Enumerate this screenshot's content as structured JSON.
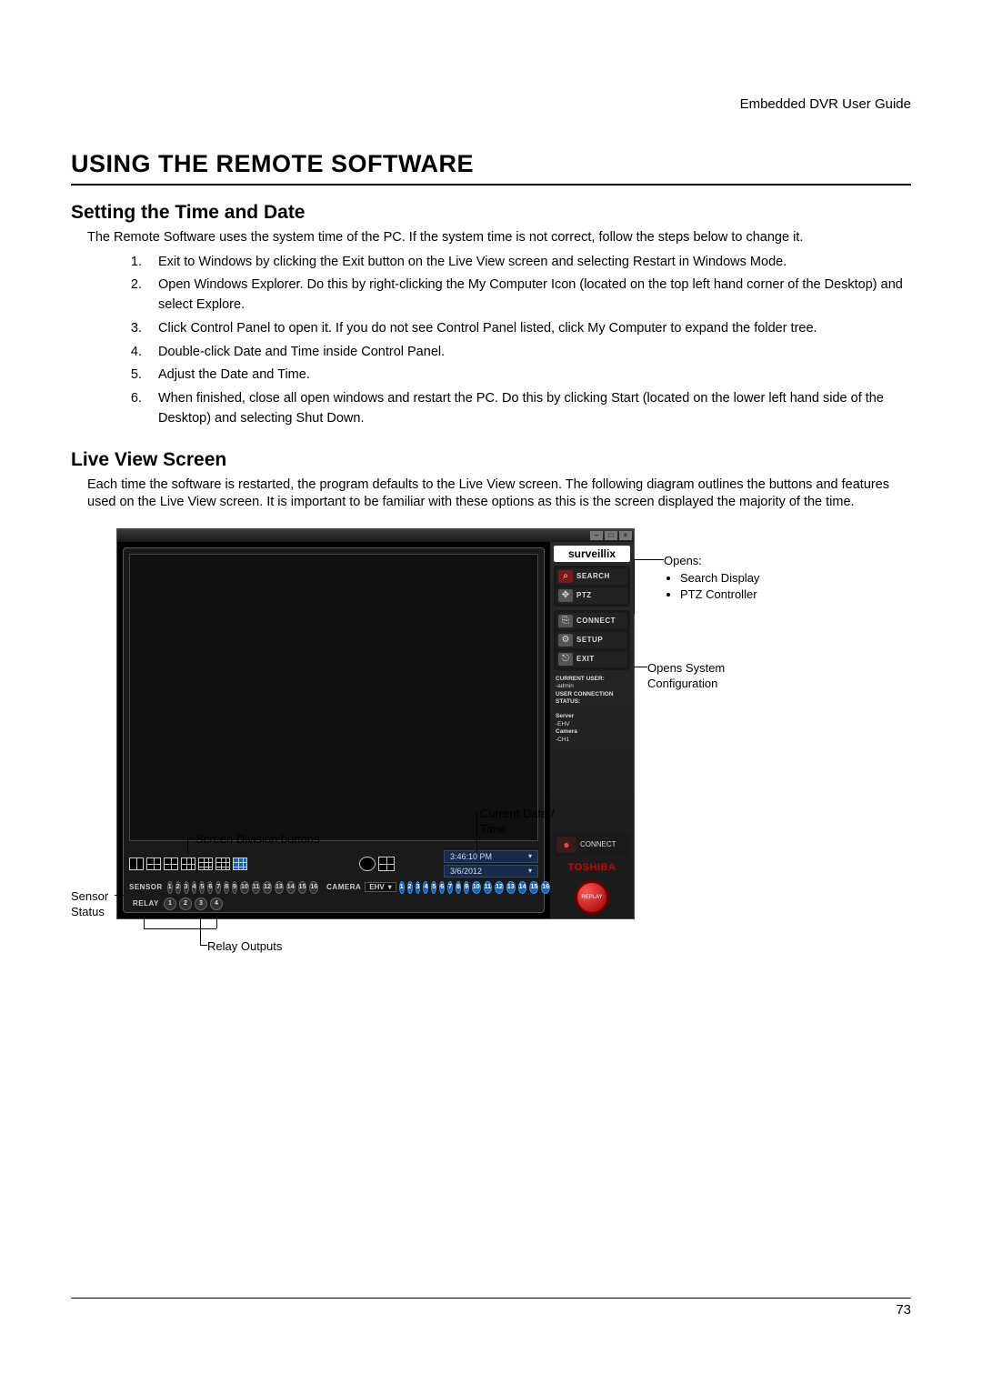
{
  "header_right": "Embedded DVR User Guide",
  "h1": "USING THE REMOTE SOFTWARE",
  "section1": {
    "title": "Setting the Time and Date",
    "intro": "The Remote Software uses the system time of the PC. If the system time is not correct, follow the steps below to change it.",
    "steps": [
      "Exit to Windows by clicking the Exit button on the Live View screen and selecting Restart in Windows Mode.",
      "Open Windows Explorer. Do this by right-clicking the My Computer Icon (located on the top left hand corner of the Desktop) and select Explore.",
      "Click Control Panel to open it. If you do not see Control Panel listed, click My Computer to expand the folder tree.",
      "Double-click Date and Time inside Control Panel.",
      "Adjust the Date and Time.",
      "When finished, close all open windows and restart the PC. Do this by clicking Start (located on the lower left hand side of the Desktop) and selecting Shut Down."
    ]
  },
  "section2": {
    "title": "Live View Screen",
    "intro": "Each time the software is restarted, the program defaults to the Live View screen. The following diagram outlines the buttons and features used on the Live View screen. It is important to be familiar with these options as this is the screen displayed the majority of the time."
  },
  "app": {
    "brand": "surveillix",
    "search": "SEARCH",
    "ptz": "PTZ",
    "connect": "CONNECT",
    "setup": "SETUP",
    "exit": "EXIT",
    "current_user_label": "CURRENT USER:",
    "current_user_value": "-admin",
    "ucs_label": "USER CONNECTION STATUS:",
    "server_label": "Server",
    "server_value": "-EHV",
    "camera_label": "Camera",
    "camera_value": "-CH1",
    "connect2": "CONNECT",
    "toshiba": "TOSHIBA",
    "replay": "REPLAY",
    "time": "3:46:10 PM",
    "date": "3/6/2012",
    "sensor_label": "SENSOR",
    "relay_label": "RELAY",
    "camera_bar_label": "CAMERA",
    "camera_select": "EHV"
  },
  "callouts": {
    "opens_label": "Opens:",
    "opens_li1": "Search Display",
    "opens_li2": "PTZ Controller",
    "setup_label": "Opens System Configuration",
    "dt_label": "Current Date / Time",
    "div_label": "Screen Division buttons",
    "sensor_label": "Sensor Status",
    "relay_label": "Relay Outputs"
  },
  "page_number": "73"
}
